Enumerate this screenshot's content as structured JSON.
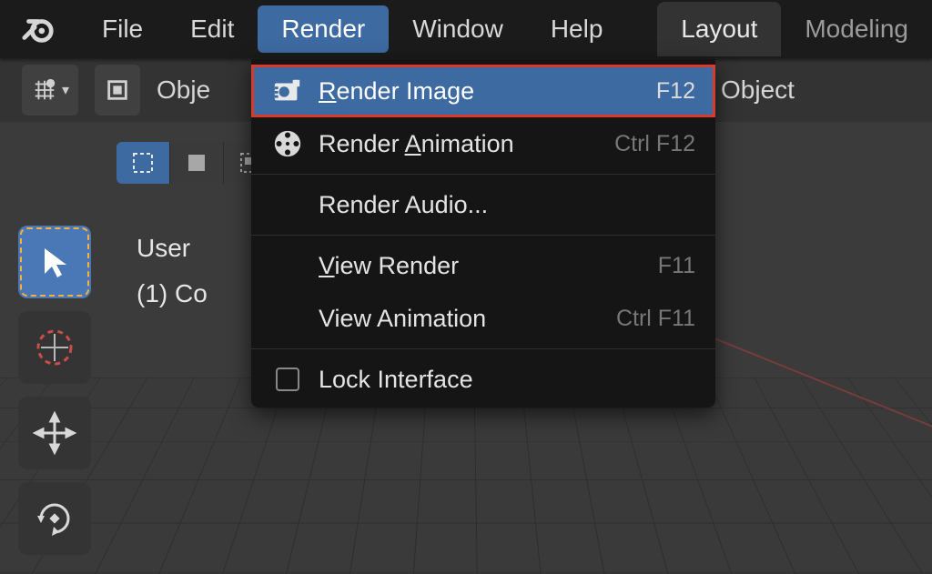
{
  "menubar": {
    "items": [
      {
        "label": "File"
      },
      {
        "label": "Edit"
      },
      {
        "label": "Render"
      },
      {
        "label": "Window"
      },
      {
        "label": "Help"
      }
    ]
  },
  "workspace_tabs": {
    "active": "Layout",
    "items": [
      {
        "label": "Layout"
      },
      {
        "label": "Modeling"
      }
    ]
  },
  "subheader": {
    "mode_label": "Obje",
    "trailing_label": "Object"
  },
  "viewport_text": {
    "line1": "User",
    "line2": "(1) Co"
  },
  "render_menu": {
    "items": [
      {
        "label": "Render Image",
        "shortcut": "F12",
        "highlight": true,
        "icon": "camera-still-icon"
      },
      {
        "label": "Render Animation",
        "shortcut": "Ctrl F12",
        "icon": "film-reel-icon"
      },
      {
        "label": "Render Audio...",
        "shortcut": ""
      },
      {
        "label": "View Render",
        "shortcut": "F11"
      },
      {
        "label": "View Animation",
        "shortcut": "Ctrl F11"
      },
      {
        "label": "Lock Interface",
        "shortcut": "",
        "checkbox": true
      }
    ]
  }
}
